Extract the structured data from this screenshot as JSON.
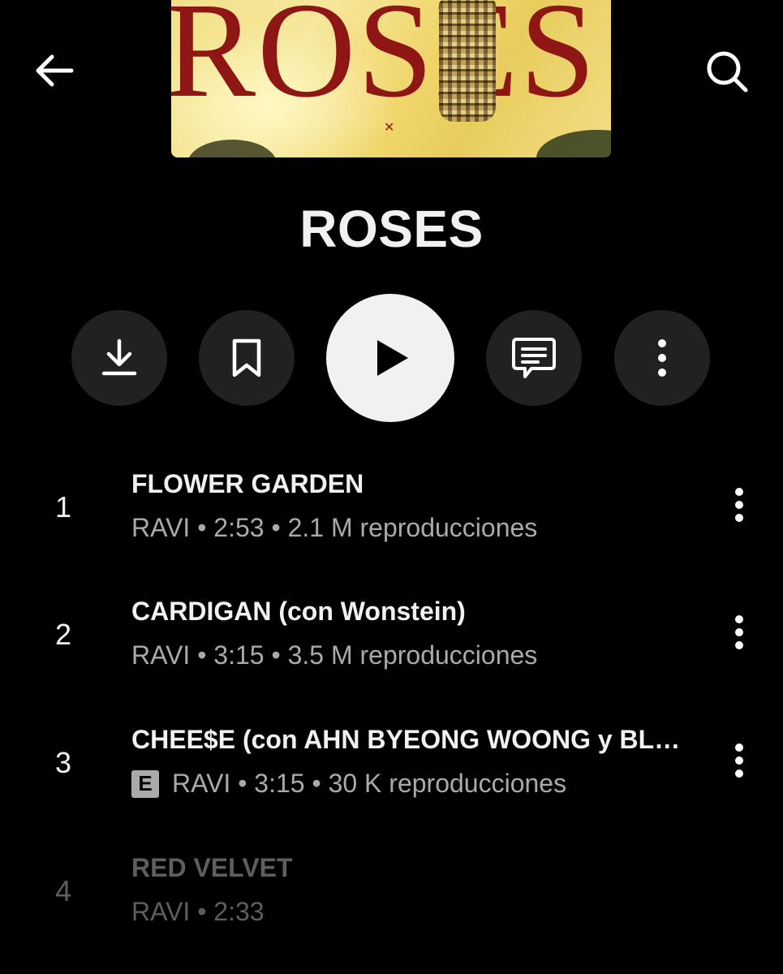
{
  "header": {
    "back_icon": "arrow-left-icon",
    "search_icon": "search-icon"
  },
  "album": {
    "cover_text": "ROSES",
    "title": "ROSES"
  },
  "actions": [
    {
      "name": "download",
      "icon": "download-icon"
    },
    {
      "name": "save",
      "icon": "bookmark-icon"
    },
    {
      "name": "play",
      "icon": "play-icon"
    },
    {
      "name": "comments",
      "icon": "comment-icon"
    },
    {
      "name": "more",
      "icon": "more-vertical-icon"
    }
  ],
  "tracks": [
    {
      "number": "1",
      "title": "FLOWER GARDEN",
      "artist": "RAVI",
      "sep1": " • ",
      "duration": "2:53",
      "sep2": " • ",
      "plays": "2.1 M reproducciones",
      "explicit": false
    },
    {
      "number": "2",
      "title": "CARDIGAN (con Wonstein)",
      "artist": "RAVI",
      "sep1": " • ",
      "duration": "3:15",
      "sep2": " • ",
      "plays": "3.5 M reproducciones",
      "explicit": false
    },
    {
      "number": "3",
      "title": "CHEE$E (con AHN BYEONG WOONG y BLN…",
      "artist": "RAVI",
      "sep1": " • ",
      "duration": "3:15",
      "sep2": " • ",
      "plays": "30 K reproducciones",
      "explicit": true,
      "explicit_label": "E"
    },
    {
      "number": "4",
      "title": "RED VELVET",
      "artist": "RAVI",
      "sep1": " • ",
      "duration": "2:33",
      "explicit": false
    }
  ],
  "colors": {
    "background": "#000000",
    "button_bg": "#212121",
    "play_bg": "#f1f1f1",
    "secondary_text": "#aaaaaa",
    "dimmed_text": "#5e5e5e",
    "cover_red": "#8e1716"
  }
}
